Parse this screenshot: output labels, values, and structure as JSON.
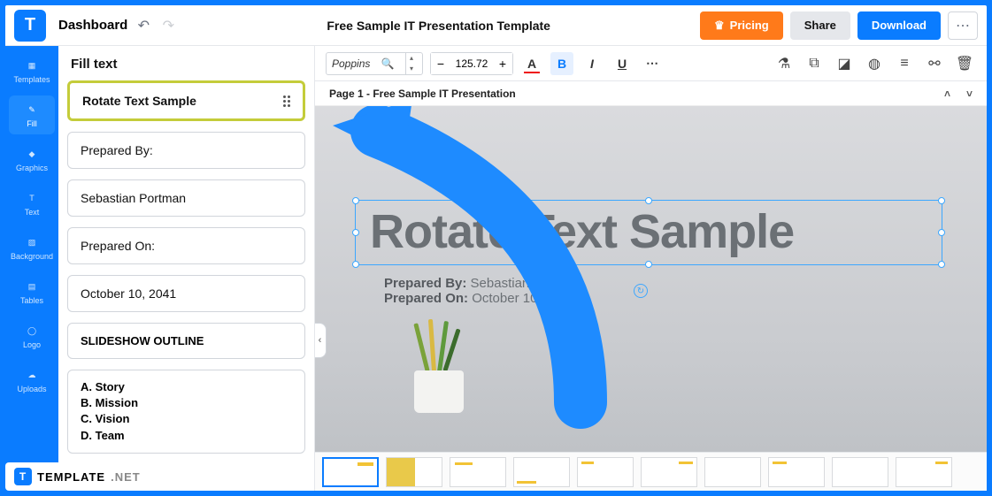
{
  "header": {
    "dashboard": "Dashboard",
    "doc_title": "Free Sample IT Presentation Template",
    "pricing": "Pricing",
    "share": "Share",
    "download": "Download"
  },
  "sidebar": {
    "items": [
      {
        "label": "Templates"
      },
      {
        "label": "Fill"
      },
      {
        "label": "Graphics"
      },
      {
        "label": "Text"
      },
      {
        "label": "Background"
      },
      {
        "label": "Tables"
      },
      {
        "label": "Logo"
      },
      {
        "label": "Uploads"
      }
    ]
  },
  "panel": {
    "title": "Fill text",
    "rotate_sample": "Rotate Text Sample",
    "prepared_by_label": "Prepared By:",
    "prepared_by_value": "Sebastian Portman",
    "prepared_on_label": "Prepared On:",
    "prepared_on_value": "October 10, 2041",
    "outline_title": "SLIDESHOW OUTLINE",
    "outline_a": "A. Story",
    "outline_b": "B. Mission",
    "outline_c": "C. Vision",
    "outline_d": "D. Team"
  },
  "toolbar": {
    "font": "Poppins",
    "size": "125.72",
    "A": "A",
    "B": "B",
    "I": "I",
    "U": "U"
  },
  "pagebar": {
    "label": "Page 1 - Free Sample IT Presentation"
  },
  "slide": {
    "big": "Rotate Text Sample",
    "prep_by_l": "Prepared By:",
    "prep_by_v": "Sebastian Portman",
    "prep_on_l": "Prepared On:",
    "prep_on_v": "October 10, 2041"
  },
  "brand": {
    "name": "TEMPLATE",
    "suffix": ".NET"
  }
}
